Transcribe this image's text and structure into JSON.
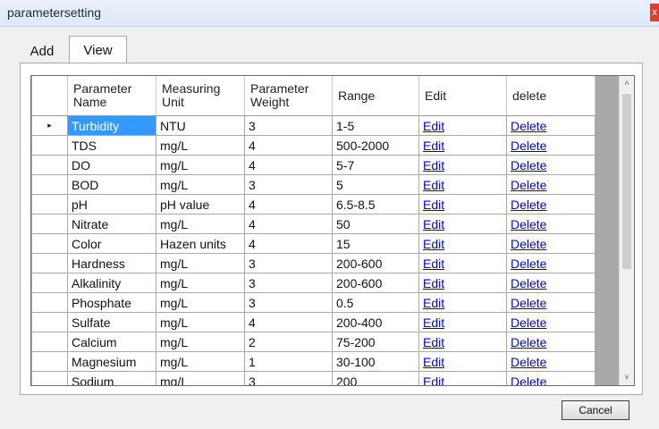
{
  "window": {
    "title": "parametersetting",
    "close_glyph": "x"
  },
  "tabs": [
    {
      "label": "Add"
    },
    {
      "label": "View"
    }
  ],
  "grid": {
    "row_indicator": "▸",
    "columns": [
      "Parameter Name",
      "Measuring Unit",
      "Parameter Weight",
      "Range",
      "Edit",
      "delete"
    ],
    "rows": [
      {
        "name": "Turbidity",
        "unit": "NTU",
        "weight": "3",
        "range": "1-5",
        "edit": "Edit",
        "delete": "Delete"
      },
      {
        "name": "TDS",
        "unit": "mg/L",
        "weight": "4",
        "range": "500-2000",
        "edit": "Edit",
        "delete": "Delete"
      },
      {
        "name": "DO",
        "unit": "mg/L",
        "weight": "4",
        "range": "5-7",
        "edit": "Edit",
        "delete": "Delete"
      },
      {
        "name": "BOD",
        "unit": "mg/L",
        "weight": "3",
        "range": "5",
        "edit": "Edit",
        "delete": "Delete"
      },
      {
        "name": "pH",
        "unit": "pH value",
        "weight": "4",
        "range": "6.5-8.5",
        "edit": "Edit",
        "delete": "Delete"
      },
      {
        "name": "Nitrate",
        "unit": "mg/L",
        "weight": "4",
        "range": "50",
        "edit": "Edit",
        "delete": "Delete"
      },
      {
        "name": "Color",
        "unit": "Hazen units",
        "weight": "4",
        "range": "15",
        "edit": "Edit",
        "delete": "Delete"
      },
      {
        "name": "Hardness",
        "unit": "mg/L",
        "weight": "3",
        "range": "200-600",
        "edit": "Edit",
        "delete": "Delete"
      },
      {
        "name": "Alkalinity",
        "unit": "mg/L",
        "weight": "3",
        "range": "200-600",
        "edit": "Edit",
        "delete": "Delete"
      },
      {
        "name": "Phosphate",
        "unit": "mg/L",
        "weight": "3",
        "range": "0.5",
        "edit": "Edit",
        "delete": "Delete"
      },
      {
        "name": "Sulfate",
        "unit": "mg/L",
        "weight": "4",
        "range": "200-400",
        "edit": "Edit",
        "delete": "Delete"
      },
      {
        "name": "Calcium",
        "unit": "mg/L",
        "weight": "2",
        "range": "75-200",
        "edit": "Edit",
        "delete": "Delete"
      },
      {
        "name": "Magnesium",
        "unit": "mg/L",
        "weight": "1",
        "range": "30-100",
        "edit": "Edit",
        "delete": "Delete"
      },
      {
        "name": "Sodium",
        "unit": "mg/L",
        "weight": "3",
        "range": "200",
        "edit": "Edit",
        "delete": "Delete"
      }
    ]
  },
  "scrollbar": {
    "up_glyph": "˄",
    "down_glyph": "˅"
  },
  "buttons": {
    "cancel": "Cancel"
  },
  "colors": {
    "selection": "#3399ff",
    "link": "#0000e6",
    "grid_background": "#a9a9a9"
  }
}
